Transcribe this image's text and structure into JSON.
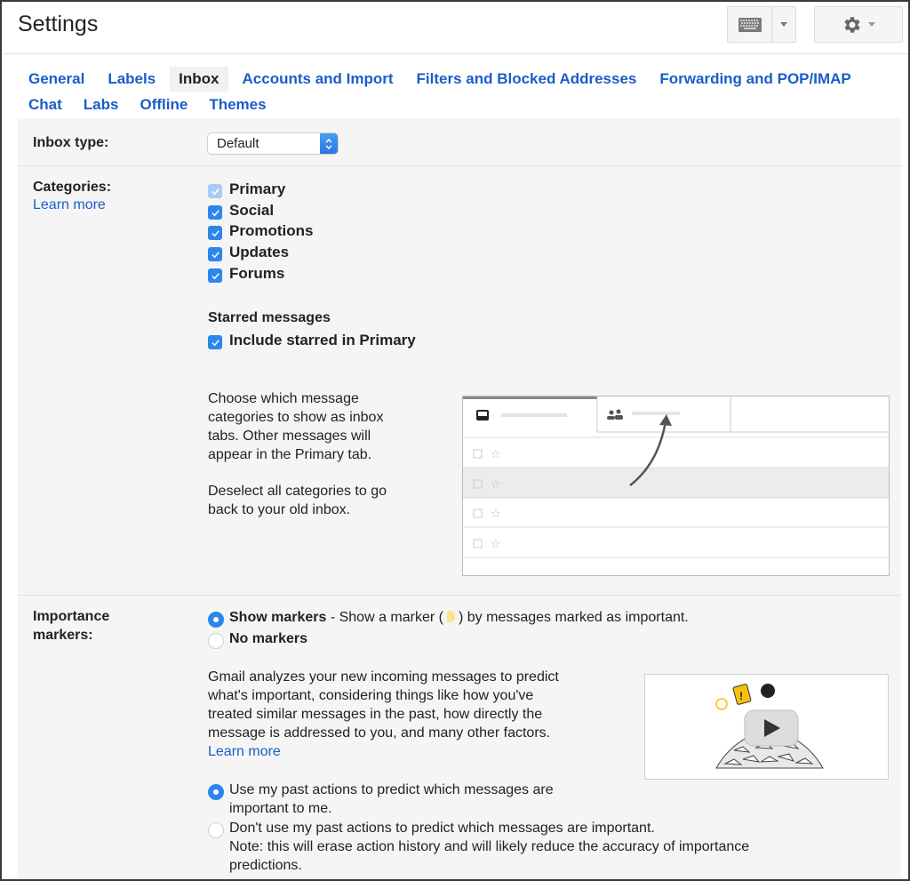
{
  "header": {
    "title": "Settings",
    "keyboard_button": "keyboard-icon",
    "settings_button": "gear-icon"
  },
  "tabs": {
    "row1": [
      {
        "label": "General",
        "active": false
      },
      {
        "label": "Labels",
        "active": false
      },
      {
        "label": "Inbox",
        "active": true
      },
      {
        "label": "Accounts and Import",
        "active": false
      },
      {
        "label": "Filters and Blocked Addresses",
        "active": false
      },
      {
        "label": "Forwarding and POP/IMAP",
        "active": false
      }
    ],
    "row2": [
      {
        "label": "Chat",
        "active": false
      },
      {
        "label": "Labs",
        "active": false
      },
      {
        "label": "Offline",
        "active": false
      },
      {
        "label": "Themes",
        "active": false
      }
    ]
  },
  "inbox_type": {
    "label": "Inbox type:",
    "selected": "Default"
  },
  "categories": {
    "label": "Categories:",
    "learn_more": "Learn more",
    "items": [
      {
        "label": "Primary",
        "checked": true,
        "disabled": true
      },
      {
        "label": "Social",
        "checked": true,
        "disabled": false
      },
      {
        "label": "Promotions",
        "checked": true,
        "disabled": false
      },
      {
        "label": "Updates",
        "checked": true,
        "disabled": false
      },
      {
        "label": "Forums",
        "checked": true,
        "disabled": false
      }
    ],
    "starred": {
      "heading": "Starred messages",
      "option": "Include starred in Primary",
      "checked": true
    },
    "description1": "Choose which message categories to show as inbox tabs. Other messages will appear in the Primary tab.",
    "description1_lines": [
      "Choose which message",
      "categories to show as inbox",
      "tabs. Other messages will",
      "appear in the Primary tab."
    ],
    "description2_lines": [
      "Deselect all categories to go",
      "back to your old inbox."
    ]
  },
  "importance": {
    "label_lines": [
      "Importance",
      "markers:"
    ],
    "show_markers": {
      "label": "Show markers",
      "desc_before": " - Show a marker (",
      "desc_after": ") by messages marked as important.",
      "selected": true
    },
    "no_markers": {
      "label": "No markers",
      "selected": false
    },
    "description_lines": [
      "Gmail analyzes your new incoming messages to predict",
      "what's important, considering things like how you've",
      "treated similar messages in the past, how directly the",
      "message is addressed to you, and many other factors."
    ],
    "learn_more": "Learn more",
    "use_past": {
      "lines": [
        "Use my past actions to predict which messages are",
        "important to me."
      ],
      "selected": true
    },
    "dont_use_past": {
      "lines": [
        "Don't use my past actions to predict which messages are important.",
        "Note: this will erase action history and will likely reduce the accuracy of importance",
        "predictions."
      ],
      "selected": false
    }
  },
  "colors": {
    "link": "#1a5dc9",
    "checkbox": "#2c86ee",
    "panel_bg": "#f5f5f5",
    "marker": "#fde293"
  }
}
